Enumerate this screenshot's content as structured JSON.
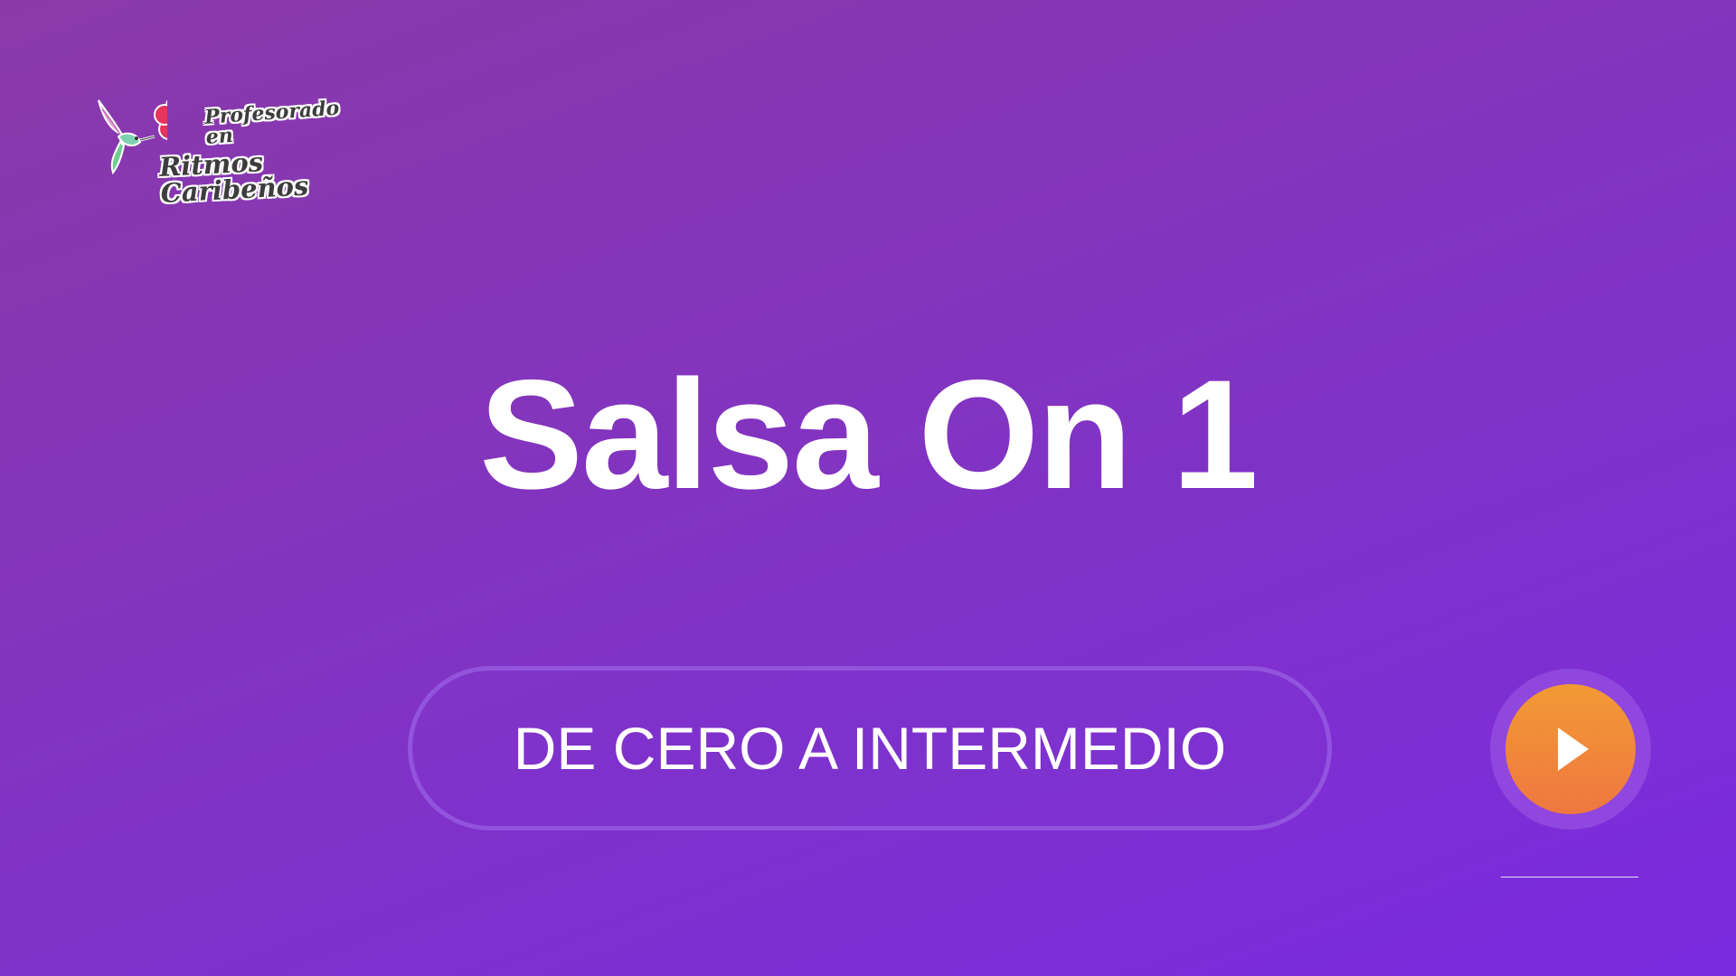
{
  "logo": {
    "line1": "Profesorado en",
    "line2": "Ritmos Caribeños"
  },
  "title": "Salsa On 1",
  "subtitle_pill": "DE CERO A INTERMEDIO",
  "play_button": {
    "icon": "play-icon"
  },
  "colors": {
    "background_start": "#8a3aa8",
    "background_end": "#7b2be0",
    "play_orange_top": "#f29a35",
    "play_orange_bottom": "#ef7740",
    "text": "#ffffff"
  }
}
